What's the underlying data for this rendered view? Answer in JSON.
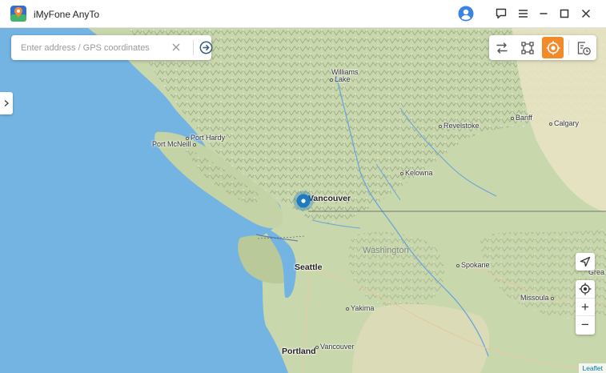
{
  "app": {
    "title": "iMyFone AnyTo"
  },
  "titlebar": {
    "icons": [
      "user-avatar-icon",
      "feedback-icon",
      "menu-icon",
      "minimize-icon",
      "maximize-icon",
      "close-icon"
    ]
  },
  "search": {
    "placeholder": "Enter address / GPS coordinates",
    "value": ""
  },
  "modes": {
    "items": [
      "multi-spot-route-icon",
      "jump-teleport-icon",
      "teleport-mode-icon",
      "history-icon"
    ],
    "active": "teleport-mode-icon",
    "accent": "#f38a29"
  },
  "map": {
    "places": {
      "williams_lake_1": "Williams",
      "williams_lake_2": "Lake",
      "port_hardy": "Port Hardy",
      "port_mcneill": "Port McNeill",
      "revelstoke": "Revelstoke",
      "banff": "Banff",
      "calgary": "Calgary",
      "kelowna": "Kelowna",
      "vancouver": "Vancouver",
      "washington": "Washington",
      "seattle": "Seattle",
      "spokane": "Spokane",
      "missoula": "Missoula",
      "yakima": "Yakima",
      "portland": "Portland",
      "vancouver_wa": "Vancouver",
      "great_falls": "Grea"
    },
    "controls": [
      "navigate-arrow-icon",
      "locate-me-icon",
      "zoom-in-icon",
      "zoom-out-icon"
    ],
    "zoom_in": "+",
    "zoom_out": "−",
    "attribution": "Leaflet",
    "colors": {
      "water": "#6fb3e3",
      "land": "#cbd8b0",
      "mountain": "#a9b58f",
      "marker": "#1f7bc0"
    }
  }
}
